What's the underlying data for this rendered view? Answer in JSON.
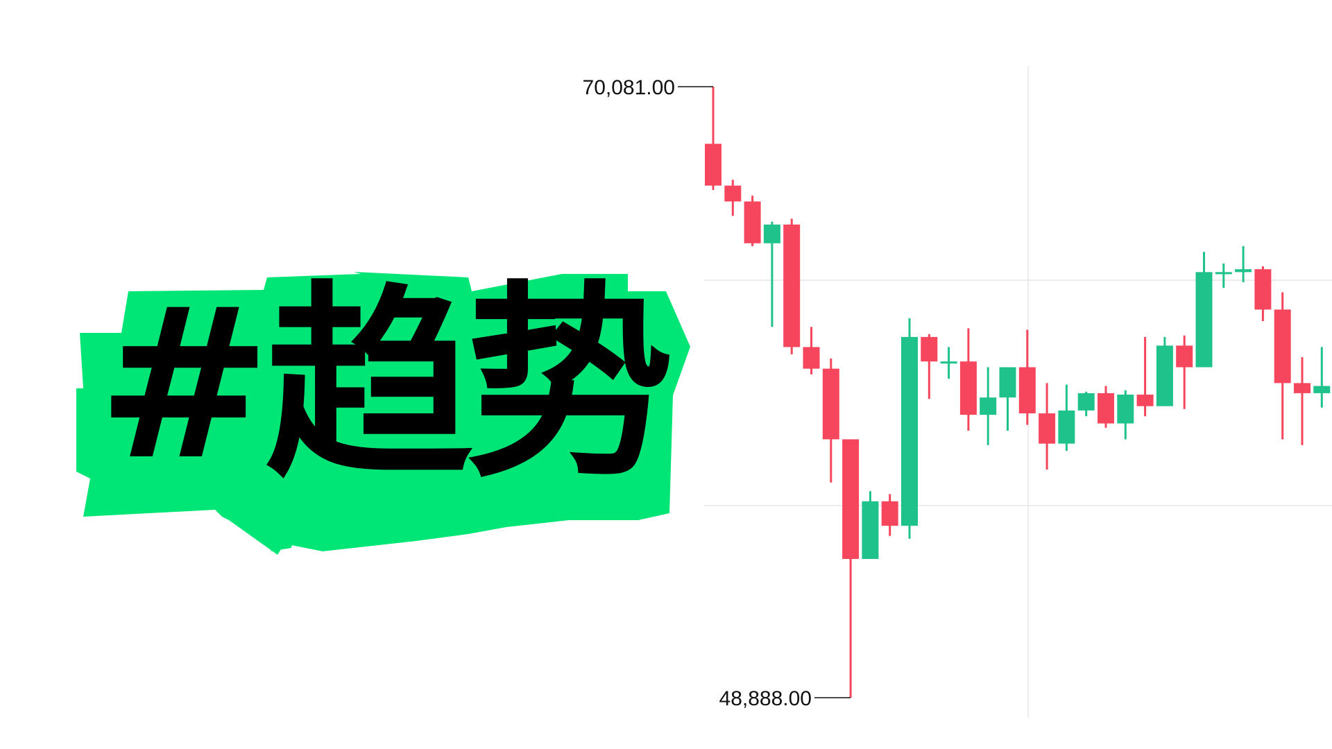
{
  "hashtag": {
    "text": "#趋势"
  },
  "colors": {
    "accent": "#00e676",
    "up": "#1fc28a",
    "down": "#f6465d",
    "grid": "#e6e6e6"
  },
  "chart_data": {
    "type": "candlestick",
    "title": "",
    "ylim": [
      48888,
      70081
    ],
    "high_label": "70,081.00",
    "low_label": "48,888.00",
    "grid": true,
    "candles": [
      {
        "o": 68100,
        "h": 70081,
        "l": 66500,
        "c": 66650
      },
      {
        "o": 66650,
        "h": 66850,
        "l": 65600,
        "c": 66100
      },
      {
        "o": 66100,
        "h": 66300,
        "l": 64550,
        "c": 64650
      },
      {
        "o": 64650,
        "h": 65400,
        "l": 61750,
        "c": 65300
      },
      {
        "o": 65300,
        "h": 65500,
        "l": 60800,
        "c": 61050
      },
      {
        "o": 61050,
        "h": 61750,
        "l": 60100,
        "c": 60300
      },
      {
        "o": 60300,
        "h": 60650,
        "l": 56350,
        "c": 57850
      },
      {
        "o": 57850,
        "h": 57850,
        "l": 48888,
        "c": 53700
      },
      {
        "o": 53700,
        "h": 56050,
        "l": 53700,
        "c": 55700
      },
      {
        "o": 55700,
        "h": 55950,
        "l": 54500,
        "c": 54850
      },
      {
        "o": 54850,
        "h": 62050,
        "l": 54400,
        "c": 61400
      },
      {
        "o": 61400,
        "h": 61500,
        "l": 59250,
        "c": 60550
      },
      {
        "o": 60550,
        "h": 61050,
        "l": 59950,
        "c": 60550
      },
      {
        "o": 60550,
        "h": 61700,
        "l": 58150,
        "c": 58700
      },
      {
        "o": 58700,
        "h": 60350,
        "l": 57650,
        "c": 59300
      },
      {
        "o": 59300,
        "h": 60350,
        "l": 58150,
        "c": 60350
      },
      {
        "o": 60350,
        "h": 61650,
        "l": 58350,
        "c": 58750
      },
      {
        "o": 58750,
        "h": 59800,
        "l": 56800,
        "c": 57700
      },
      {
        "o": 57700,
        "h": 59750,
        "l": 57450,
        "c": 58850
      },
      {
        "o": 58850,
        "h": 59500,
        "l": 58650,
        "c": 59450
      },
      {
        "o": 59450,
        "h": 59700,
        "l": 58250,
        "c": 58400
      },
      {
        "o": 58400,
        "h": 59550,
        "l": 57850,
        "c": 59400
      },
      {
        "o": 59400,
        "h": 61400,
        "l": 58650,
        "c": 59000
      },
      {
        "o": 59000,
        "h": 61400,
        "l": 59000,
        "c": 61100
      },
      {
        "o": 61100,
        "h": 61450,
        "l": 58900,
        "c": 60350
      },
      {
        "o": 60350,
        "h": 64350,
        "l": 60350,
        "c": 63650
      },
      {
        "o": 63650,
        "h": 63950,
        "l": 63100,
        "c": 63650
      },
      {
        "o": 63650,
        "h": 64550,
        "l": 63300,
        "c": 63750
      },
      {
        "o": 63750,
        "h": 63850,
        "l": 61950,
        "c": 62350
      },
      {
        "o": 62350,
        "h": 62950,
        "l": 57850,
        "c": 59800
      },
      {
        "o": 59800,
        "h": 60700,
        "l": 57650,
        "c": 59450
      },
      {
        "o": 59450,
        "h": 61050,
        "l": 58950,
        "c": 59700
      }
    ]
  }
}
